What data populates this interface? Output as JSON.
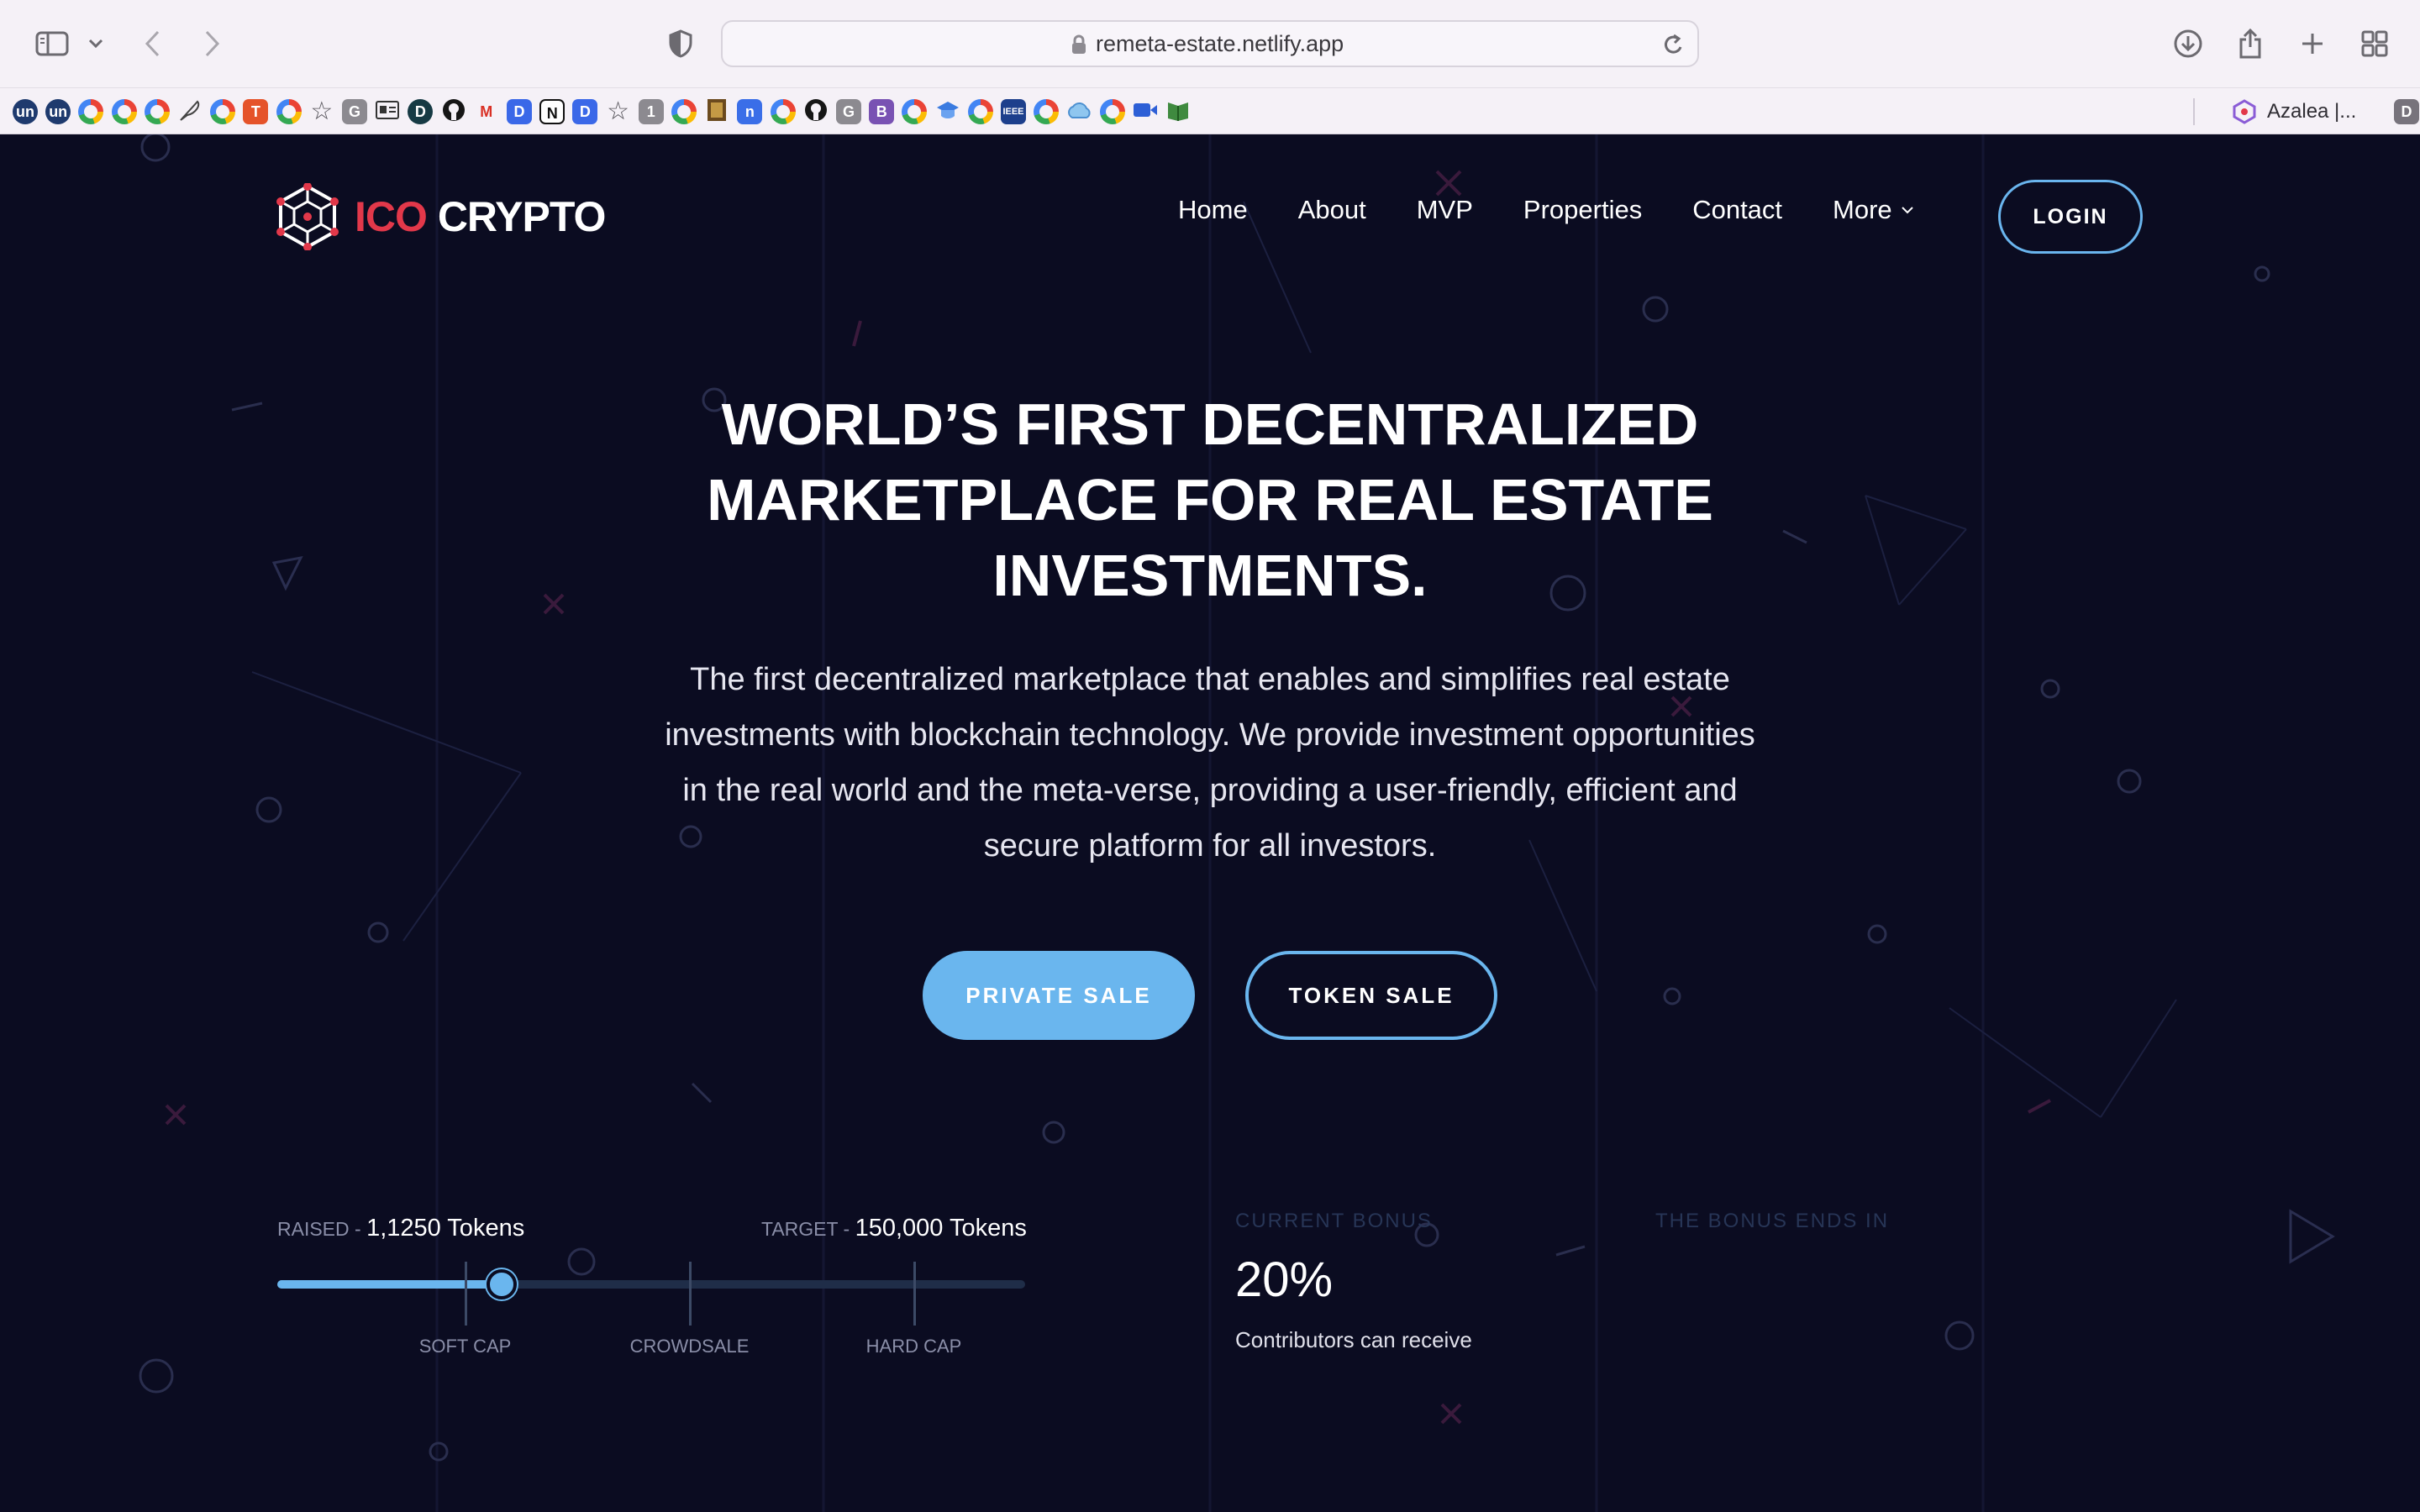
{
  "browser": {
    "url": "remeta-estate.netlify.app",
    "bookmarks": [
      {
        "icon": "unsplash-icon",
        "text": "un"
      },
      {
        "icon": "unsplash-icon",
        "text": "un"
      },
      {
        "icon": "google-icon"
      },
      {
        "icon": "google-icon"
      },
      {
        "icon": "google-icon"
      },
      {
        "icon": "feather-icon"
      },
      {
        "icon": "google-icon"
      },
      {
        "icon": "tally-icon",
        "text": "T"
      },
      {
        "icon": "google-icon"
      },
      {
        "icon": "star-icon"
      },
      {
        "icon": "grammarly-icon",
        "text": "G"
      },
      {
        "icon": "id-card-icon"
      },
      {
        "icon": "d-icon",
        "text": "D"
      },
      {
        "icon": "github-icon"
      },
      {
        "icon": "gmail-icon",
        "text": "M"
      },
      {
        "icon": "d-blue-icon",
        "text": "D"
      },
      {
        "icon": "notion-icon",
        "text": "N"
      },
      {
        "icon": "d-blue-icon",
        "text": "D"
      },
      {
        "icon": "star-icon"
      },
      {
        "icon": "one-icon",
        "text": "1"
      },
      {
        "icon": "google-icon"
      },
      {
        "icon": "book-icon"
      },
      {
        "icon": "n-icon",
        "text": "n"
      },
      {
        "icon": "google-icon"
      },
      {
        "icon": "github-icon"
      },
      {
        "icon": "grammarly-icon",
        "text": "G"
      },
      {
        "icon": "bootstrap-icon",
        "text": "B"
      },
      {
        "icon": "google-icon"
      },
      {
        "icon": "cap-icon"
      },
      {
        "icon": "google-icon"
      },
      {
        "icon": "ieee-icon",
        "text": "IEEE"
      },
      {
        "icon": "google-icon"
      },
      {
        "icon": "cloud-icon"
      },
      {
        "icon": "google-icon"
      },
      {
        "icon": "video-icon"
      },
      {
        "icon": "book-green-icon"
      }
    ],
    "azalea_label": "Azalea |...",
    "last_bookmark_text": "D"
  },
  "site": {
    "logo_part1": "ICO",
    "logo_part2": "CRYPTO",
    "nav": [
      "Home",
      "About",
      "MVP",
      "Properties",
      "Contact",
      "More"
    ],
    "login": "LOGIN",
    "hero_title": "WORLD’S FIRST DECENTRALIZED MARKETPLACE FOR REAL ESTATE INVESTMENTS.",
    "hero_desc": "The first decentralized marketplace that enables and simplifies real estate investments with blockchain technology. We provide investment opportunities in the real world and the meta-verse, providing a user-friendly, efficient and secure platform for all investors.",
    "btn_private": "PRIVATE SALE",
    "btn_token": "TOKEN SALE",
    "raised_label": "RAISED - ",
    "raised_value": "1,1250 Tokens",
    "target_label": "TARGET - ",
    "target_value": "150,000 Tokens",
    "progress_fraction": 0.3,
    "markers": [
      {
        "label": "SOFT CAP",
        "position": 0.25
      },
      {
        "label": "CROWDSALE",
        "position": 0.55
      },
      {
        "label": "HARD CAP",
        "position": 0.85
      }
    ],
    "bonus_label": "CURRENT BONUS",
    "bonus_value": "20%",
    "bonus_note": "Contributors can receive",
    "bonus_ends_label": "THE BONUS ENDS IN"
  },
  "colors": {
    "background": "#0b0c21",
    "accent": "#6ab6ee",
    "logo_red": "#e2384a"
  }
}
